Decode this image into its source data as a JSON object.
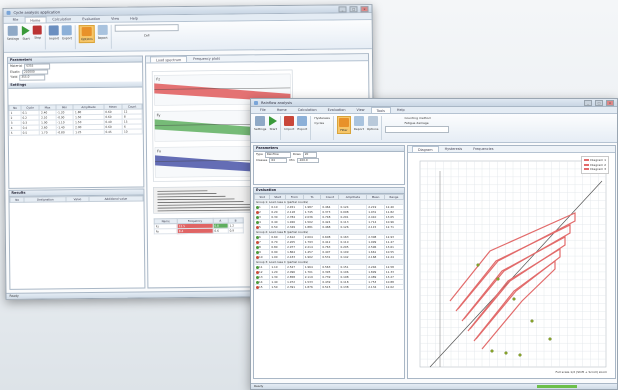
{
  "back_window": {
    "title": "Cycle analysis application",
    "tabs": [
      "File",
      "Home",
      "Calculation",
      "Evaluation",
      "View",
      "Help"
    ],
    "ribbon": {
      "buttons": [
        "Settings",
        "Start",
        "Stop",
        "Import",
        "Export",
        "Options",
        "Report"
      ],
      "right_label": "Cell"
    },
    "left_panel": {
      "title": "Parameters",
      "fields": [
        {
          "label": "Material",
          "value": "S355"
        },
        {
          "label": "Elastic",
          "value": "210000"
        },
        {
          "label": "Yield",
          "value": "355.0"
        }
      ],
      "settings_title": "Settings",
      "table_headers": [
        "No",
        "Cycle",
        "Max",
        "Min",
        "Amplitude",
        "Mean",
        "Count"
      ],
      "table_rows": [
        [
          "1",
          "0.1",
          "2.40",
          "-1.20",
          "1.80",
          "0.60",
          "12"
        ],
        [
          "2",
          "0.2",
          "2.10",
          "-0.90",
          "1.50",
          "0.60",
          "8"
        ],
        [
          "3",
          "0.3",
          "1.90",
          "-1.10",
          "1.50",
          "0.40",
          "15"
        ],
        [
          "4",
          "0.4",
          "2.60",
          "-1.40",
          "2.00",
          "0.60",
          "6"
        ],
        [
          "5",
          "0.5",
          "1.70",
          "-0.80",
          "1.25",
          "0.45",
          "10"
        ]
      ],
      "results_title": "Results",
      "results_headers": [
        "No",
        "Designation",
        "Value",
        "Additional value"
      ]
    },
    "chart_panel": {
      "tabs": [
        "Load spectrum",
        "Frequency plots"
      ],
      "bands": [
        {
          "name": "Fz",
          "color": "#e05a5a"
        },
        {
          "name": "Fy",
          "color": "#5fb05f"
        },
        {
          "name": "Fx",
          "color": "#4a55a8"
        }
      ],
      "table_headers": [
        "Name",
        "Frequency",
        "A",
        "B"
      ],
      "table_rows": [
        [
          "Fz",
          "12.5",
          "0.8",
          "1.2"
        ],
        [
          "Fy",
          "8.4",
          "0.6",
          "0.9"
        ]
      ]
    },
    "status": "Ready"
  },
  "front_window": {
    "title": "Rainflow analysis",
    "tabs": [
      "File",
      "Home",
      "Calculation",
      "Evaluation",
      "View",
      "Tools",
      "Help"
    ],
    "ribbon": {
      "buttons": [
        "Settings",
        "Start",
        "Import",
        "Export",
        "Filter",
        "Report",
        "Options"
      ],
      "options": [
        "Hysteresis",
        "Cycles",
        "Counting method",
        "Fatigue damage"
      ]
    },
    "parameters": {
      "title": "Parameters",
      "fields": [
        {
          "label": "Type",
          "value": "Rainflow"
        },
        {
          "label": "Rows",
          "value": "20"
        },
        {
          "label": "Classes",
          "value": "64"
        },
        {
          "label": "Min",
          "value": "-100.0"
        }
      ]
    },
    "evaluation": {
      "title": "Evaluation",
      "headers": [
        "Slot",
        "Start",
        "From",
        "To",
        "Count",
        "Amplitude",
        "Mean",
        "Range"
      ],
      "groups": [
        {
          "label": "Group 1: Load case A (partial counts)",
          "rows": [
            [
              "1",
              "0.10",
              "2.451",
              "1.987",
              "0.464",
              "0.124",
              "2.219",
              "12.40"
            ],
            [
              "2",
              "0.20",
              "2.118",
              "1.745",
              "0.373",
              "0.098",
              "1.931",
              "11.82"
            ],
            [
              "3",
              "0.30",
              "2.784",
              "2.036",
              "0.748",
              "0.201",
              "2.410",
              "13.05"
            ],
            [
              "4",
              "0.40",
              "1.926",
              "1.502",
              "0.424",
              "0.113",
              "1.714",
              "10.96"
            ],
            [
              "5",
              "0.50",
              "2.349",
              "1.881",
              "0.468",
              "0.126",
              "2.115",
              "12.71"
            ]
          ]
        },
        {
          "label": "Group 2: Load case B (partial counts)",
          "rows": [
            [
              "6",
              "0.60",
              "2.612",
              "2.004",
              "0.608",
              "0.163",
              "2.308",
              "12.93"
            ],
            [
              "7",
              "0.70",
              "2.205",
              "1.793",
              "0.412",
              "0.110",
              "1.999",
              "11.47"
            ],
            [
              "8",
              "0.80",
              "2.977",
              "2.214",
              "0.763",
              "0.205",
              "2.596",
              "13.61"
            ],
            [
              "9",
              "0.90",
              "1.864",
              "1.457",
              "0.407",
              "0.109",
              "1.661",
              "10.55"
            ],
            [
              "10",
              "1.00",
              "2.433",
              "1.902",
              "0.531",
              "0.142",
              "2.168",
              "12.24"
            ]
          ]
        },
        {
          "label": "Group 3: Load case C (partial counts)",
          "rows": [
            [
              "11",
              "1.10",
              "2.527",
              "1.964",
              "0.563",
              "0.151",
              "2.246",
              "12.58"
            ],
            [
              "12",
              "1.20",
              "2.096",
              "1.701",
              "0.395",
              "0.106",
              "1.899",
              "11.33"
            ],
            [
              "13",
              "1.30",
              "2.858",
              "2.119",
              "0.739",
              "0.198",
              "2.489",
              "13.27"
            ],
            [
              "14",
              "1.40",
              "1.972",
              "1.533",
              "0.439",
              "0.118",
              "1.753",
              "10.88"
            ],
            [
              "15",
              "1.50",
              "2.391",
              "1.876",
              "0.515",
              "0.138",
              "2.134",
              "12.02"
            ]
          ]
        }
      ]
    },
    "chart": {
      "tabs": [
        "Diagram",
        "Hysteresis",
        "Frequencies"
      ],
      "legend": [
        "Diagram 1",
        "Diagram 2",
        "Diagram 3"
      ],
      "footer": "Full scale 1/2 (Shift + Scroll) zoom",
      "colors": {
        "diagonal": "#555555",
        "loops": "#e26b6b",
        "markers": "#8aa62a"
      }
    },
    "status": "Ready"
  }
}
